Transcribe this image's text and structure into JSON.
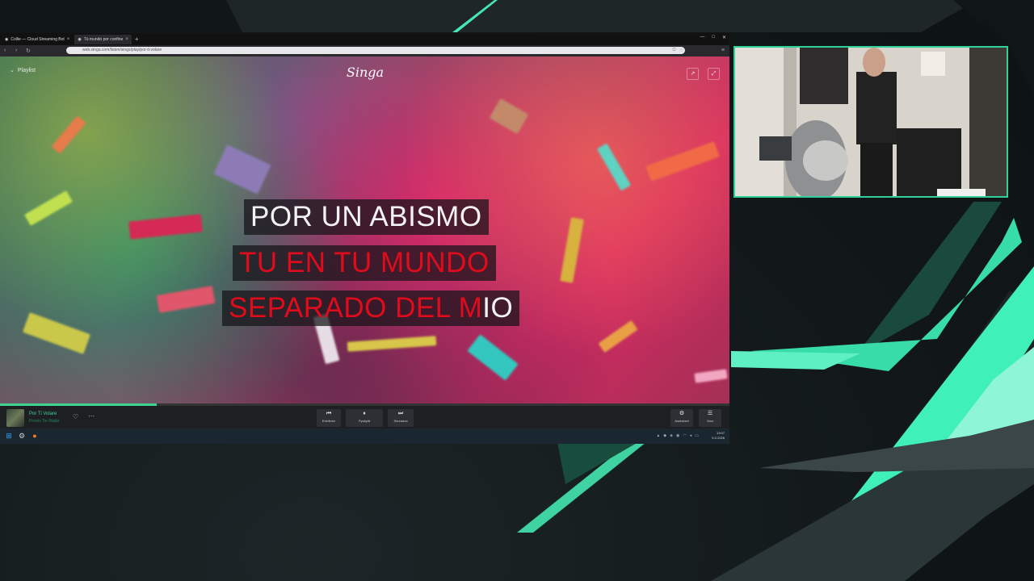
{
  "browser": {
    "tabs": [
      {
        "label": "Collie — Cloud Streaming Bot",
        "active": false
      },
      {
        "label": "Tú mundo por confine",
        "active": true
      }
    ],
    "url": "web.singa.com/listen/sings/play/por-ti-volare",
    "window_controls": [
      "—",
      "□",
      "✕"
    ]
  },
  "singa": {
    "playlist_label": "Playlist",
    "logo": "Singa",
    "lyrics": {
      "line1": "POR UN ABISMO",
      "line2": "TU EN TU MUNDO",
      "line3_sung": "SEPARADO DEL M",
      "line3_rest": "IO"
    },
    "progress_fraction": 0.215
  },
  "player": {
    "song_title": "Por Ti Volare",
    "song_artist": "Pronto Tor Radio",
    "buttons": [
      {
        "icon": "⏮",
        "label": "Edellinen"
      },
      {
        "icon": "⏸",
        "label": "Pysäytä"
      },
      {
        "icon": "⏭",
        "label": "Seuraava"
      }
    ],
    "right_buttons": [
      {
        "icon": "⚙",
        "label": "Asetukset"
      },
      {
        "icon": "☰",
        "label": "Jono"
      }
    ]
  },
  "taskbar": {
    "time": "13:07",
    "date": "5.2.2026"
  },
  "colors": {
    "accent": "#3ed38f",
    "lyric_sung": "#e00b1b",
    "cam_border": "#2fd09a"
  }
}
